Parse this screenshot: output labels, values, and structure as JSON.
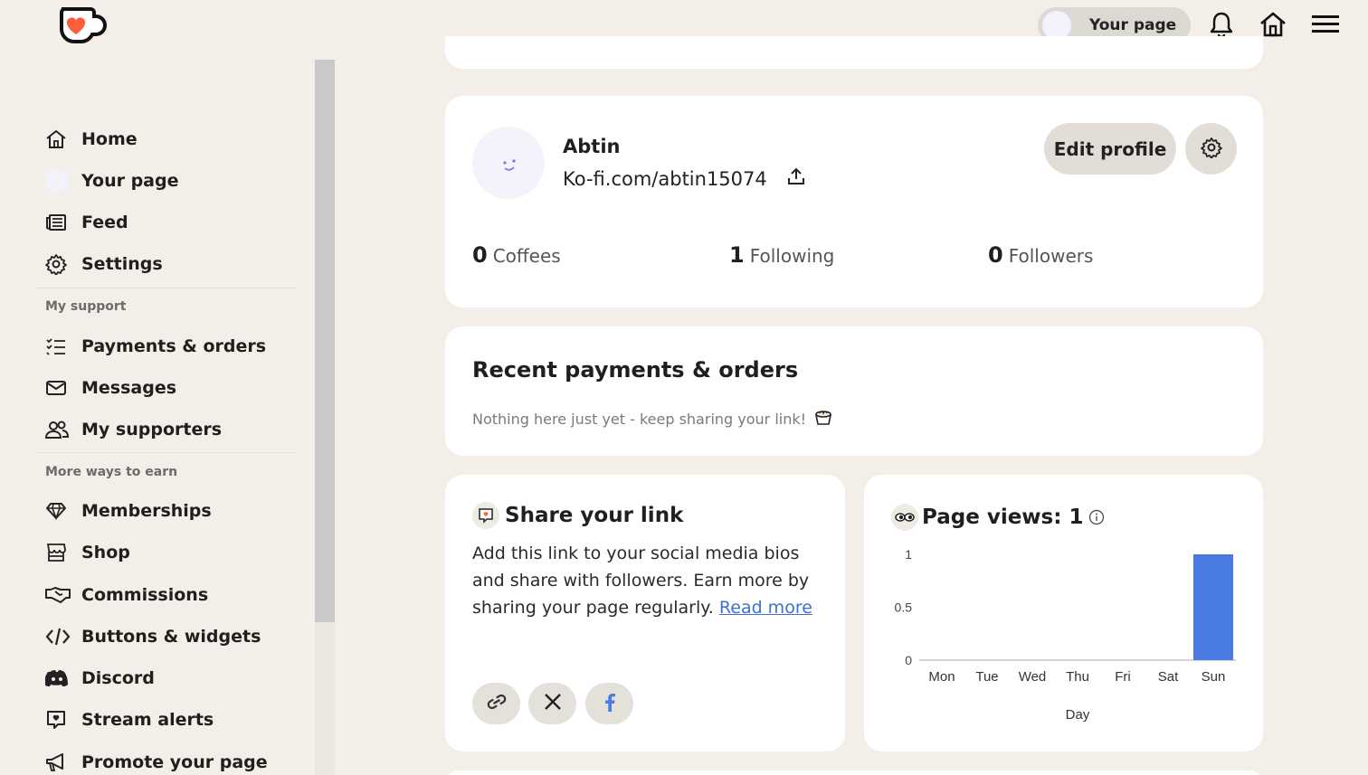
{
  "topbar": {
    "your_page_label": "Your page",
    "icons": [
      "bell-icon",
      "home-icon",
      "menu-icon"
    ]
  },
  "sidebar": {
    "items": [
      {
        "label": "Home",
        "icon": "home-icon"
      },
      {
        "label": "Your page",
        "icon": "avatar"
      },
      {
        "label": "Feed",
        "icon": "newspaper-icon"
      },
      {
        "label": "Settings",
        "icon": "gear-icon"
      }
    ],
    "section_support": "My support",
    "support_items": [
      {
        "label": "Payments & orders",
        "icon": "list-check-icon"
      },
      {
        "label": "Messages",
        "icon": "envelope-icon"
      },
      {
        "label": "My supporters",
        "icon": "users-icon"
      }
    ],
    "section_earn": "More ways to earn",
    "earn_items": [
      {
        "label": "Memberships",
        "icon": "gem-icon"
      },
      {
        "label": "Shop",
        "icon": "store-icon"
      },
      {
        "label": "Commissions",
        "icon": "handshake-icon"
      },
      {
        "label": "Buttons & widgets",
        "icon": "code-icon"
      },
      {
        "label": "Discord",
        "icon": "discord-icon"
      },
      {
        "label": "Stream alerts",
        "icon": "alert-heart-icon"
      },
      {
        "label": "Promote your page",
        "icon": "megaphone-icon"
      }
    ]
  },
  "profile": {
    "name": "Abtin",
    "url": "Ko-fi.com/abtin15074",
    "edit_label": "Edit profile",
    "stats": [
      {
        "value": "0",
        "label": "Coffees"
      },
      {
        "value": "1",
        "label": "Following"
      },
      {
        "value": "0",
        "label": "Followers"
      }
    ]
  },
  "recent": {
    "title": "Recent payments & orders",
    "empty_text": "Nothing here just yet - keep sharing your link!"
  },
  "share": {
    "title": "Share your link",
    "body": "Add this link to your social media bios and share with followers. Earn more by sharing your page regularly.",
    "read_more": "Read more"
  },
  "views": {
    "title": "Page views: 1"
  },
  "colors": {
    "bar": "#4a7be3",
    "accent_purple": "#b89af0",
    "link": "#3d6fd6"
  },
  "chart_data": {
    "type": "bar",
    "categories": [
      "Mon",
      "Tue",
      "Wed",
      "Thu",
      "Fri",
      "Sat",
      "Sun"
    ],
    "values": [
      0,
      0,
      0,
      0,
      0,
      0,
      1
    ],
    "xlabel": "Day",
    "ylabel": "",
    "ylim": [
      0,
      1
    ],
    "yticks": [
      "0",
      "0.5",
      "1"
    ],
    "grid": false
  }
}
